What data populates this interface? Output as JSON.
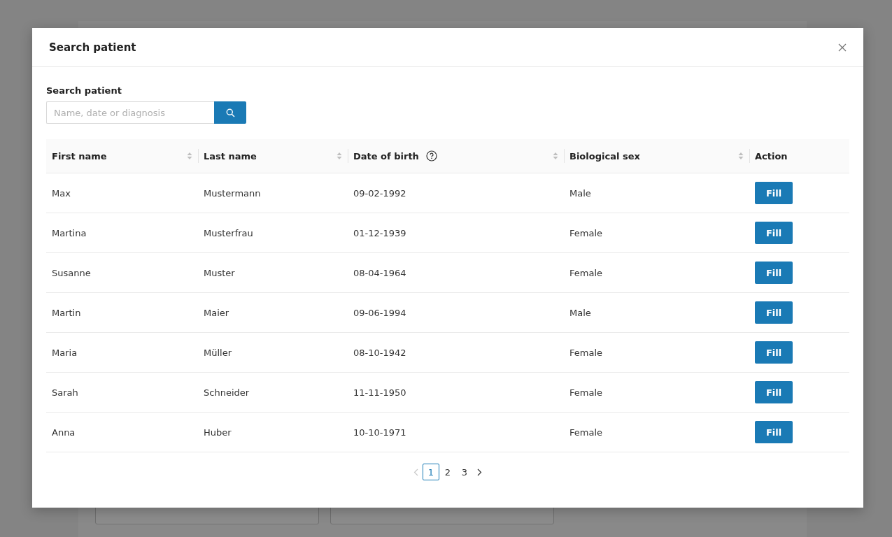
{
  "dialog": {
    "title": "Search patient"
  },
  "search": {
    "label": "Search patient",
    "placeholder": "Name, date or diagnosis"
  },
  "table": {
    "columns": [
      {
        "label": "First name",
        "sortable": true,
        "help": false
      },
      {
        "label": "Last name",
        "sortable": true,
        "help": false
      },
      {
        "label": "Date of birth",
        "sortable": true,
        "help": true
      },
      {
        "label": "Biological sex",
        "sortable": true,
        "help": false
      },
      {
        "label": "Action",
        "sortable": false,
        "help": false
      }
    ],
    "rows": [
      {
        "first_name": "Max",
        "last_name": "Mustermann",
        "date_of_birth": "09-02-1992",
        "sex": "Male",
        "action": "Fill"
      },
      {
        "first_name": "Martina",
        "last_name": "Musterfrau",
        "date_of_birth": "01-12-1939",
        "sex": "Female",
        "action": "Fill"
      },
      {
        "first_name": "Susanne",
        "last_name": "Muster",
        "date_of_birth": "08-04-1964",
        "sex": "Female",
        "action": "Fill"
      },
      {
        "first_name": "Martin",
        "last_name": "Maier",
        "date_of_birth": "09-06-1994",
        "sex": "Male",
        "action": "Fill"
      },
      {
        "first_name": "Maria",
        "last_name": "Müller",
        "date_of_birth": "08-10-1942",
        "sex": "Female",
        "action": "Fill"
      },
      {
        "first_name": "Sarah",
        "last_name": "Schneider",
        "date_of_birth": "11-11-1950",
        "sex": "Female",
        "action": "Fill"
      },
      {
        "first_name": "Anna",
        "last_name": "Huber",
        "date_of_birth": "10-10-1971",
        "sex": "Female",
        "action": "Fill"
      }
    ]
  },
  "pagination": {
    "previous_disabled": true,
    "next_disabled": false,
    "pages": [
      {
        "label": "1",
        "selected": true
      },
      {
        "label": "2",
        "selected": false
      },
      {
        "label": "3",
        "selected": false
      }
    ]
  }
}
